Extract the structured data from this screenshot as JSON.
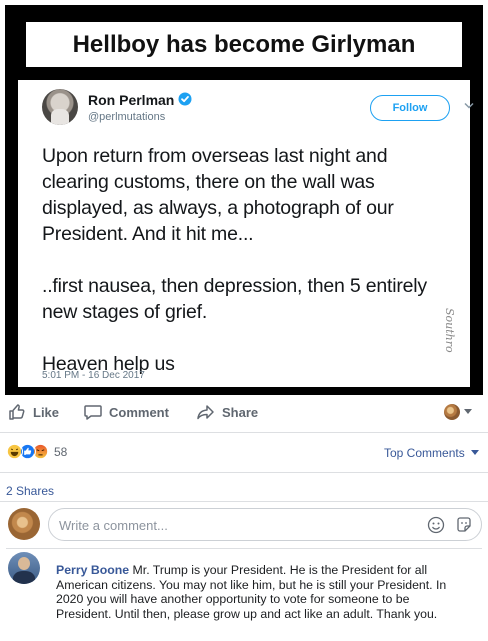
{
  "meme": {
    "title": "Hellboy has become Girlyman",
    "signature": "Southro"
  },
  "tweet": {
    "name": "Ron Perlman",
    "handle": "@perlmutations",
    "follow_label": "Follow",
    "paragraphs": [
      "Upon return from overseas last night and\nclearing customs, there on the wall was\ndisplayed, as always, a photograph of our\nPresident. And it hit me...",
      "..first nausea, then depression, then 5 entirely\nnew stages of grief.",
      "Heaven help us"
    ],
    "timestamp": "5:01 PM - 16 Dec 2017",
    "colors": {
      "accent": "#1da1f2",
      "text": "#14171a",
      "muted": "#657786"
    }
  },
  "actions": {
    "like_label": "Like",
    "comment_label": "Comment",
    "share_label": "Share"
  },
  "reactions": {
    "icons": [
      "haha",
      "like",
      "angry"
    ],
    "count": "58",
    "sort_label": "Top Comments"
  },
  "shares_label": "2 Shares",
  "composer": {
    "placeholder": "Write a comment..."
  },
  "comment": {
    "author": "Perry Boone",
    "text": " Mr. Trump is your President. He is the President for all American citizens. You may not like him, but he is still your President. In 2020 you will have another opportunity to vote for someone to be President. Until then, please grow up and act like an adult. Thank you."
  },
  "theme": {
    "link_color": "#385898",
    "action_color": "#606770",
    "divider_color": "#dddfe2"
  }
}
